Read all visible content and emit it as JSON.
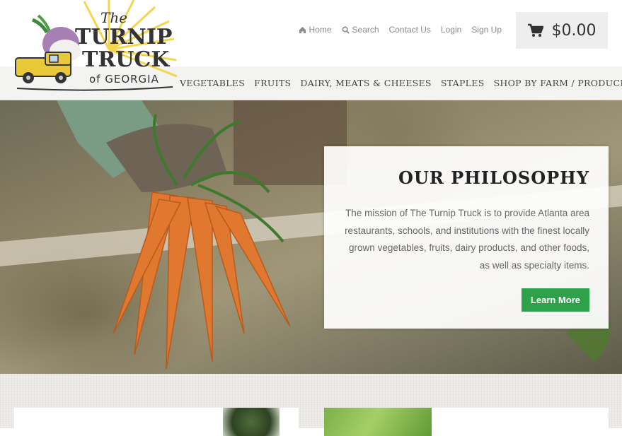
{
  "brand": {
    "logo_line1": "The",
    "logo_line2": "TURNIP",
    "logo_line3": "TRUCK",
    "logo_line4": "of GEORGIA"
  },
  "top_links": [
    {
      "label": "Home",
      "icon": "home-icon"
    },
    {
      "label": "Search",
      "icon": "search-icon"
    },
    {
      "label": "Contact Us"
    },
    {
      "label": "Login"
    },
    {
      "label": "Sign Up"
    }
  ],
  "cart": {
    "amount": "$0.00",
    "icon": "cart-icon"
  },
  "main_nav": [
    "VEGETABLES",
    "FRUITS",
    "DAIRY, MEATS & CHEESES",
    "STAPLES",
    "SHOP BY FARM / PRODUCER"
  ],
  "hero": {
    "title": "OUR PHILOSOPHY",
    "text": "The mission of The Turnip Truck is to provide Atlanta area restaurants, schools, and institutions with the finest locally grown vegetables, fruits, dairy products, and other foods, as well as specialty items.",
    "button": "Learn More"
  },
  "colors": {
    "accent_green": "#2ea24a",
    "nav_band": "#f3f3f1",
    "logo_yellow": "#f2d23b",
    "logo_purple": "#a67fb5"
  }
}
